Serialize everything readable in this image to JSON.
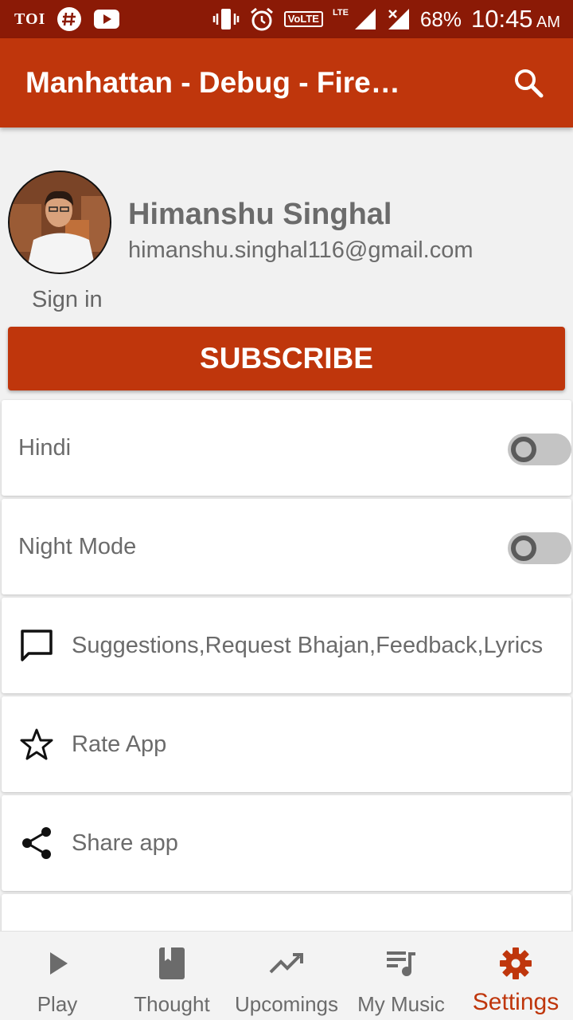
{
  "status_bar": {
    "left_text": "TOI",
    "battery": "68%",
    "time": "10:45",
    "ampm": "AM",
    "volte": "VoLTE",
    "lte": "LTE",
    "icons": [
      "hash-icon",
      "youtube-icon",
      "vibrate-icon",
      "alarm-icon",
      "signal-icon",
      "no-signal-icon"
    ]
  },
  "app_bar": {
    "title": "Manhattan - Debug - Fire…",
    "search_icon": "search-icon"
  },
  "profile": {
    "name": "Himanshu Singhal",
    "email": "himanshu.singhal116@gmail.com",
    "sign_in": "Sign in"
  },
  "subscribe_label": "SUBSCRIBE",
  "settings": [
    {
      "label": "Hindi",
      "type": "toggle",
      "on": false
    },
    {
      "label": "Night Mode",
      "type": "toggle",
      "on": false
    },
    {
      "label": "Suggestions,Request Bhajan,Feedback,Lyrics",
      "type": "link",
      "icon": "comment-icon"
    },
    {
      "label": "Rate App",
      "type": "link",
      "icon": "star-icon"
    },
    {
      "label": "Share app",
      "type": "link",
      "icon": "share-icon"
    }
  ],
  "bottom_nav": {
    "items": [
      {
        "label": "Play",
        "icon": "play-icon",
        "active": false
      },
      {
        "label": "Thought",
        "icon": "book-icon",
        "active": false
      },
      {
        "label": "Upcomings",
        "icon": "trending-icon",
        "active": false
      },
      {
        "label": "My Music",
        "icon": "playlist-icon",
        "active": false
      },
      {
        "label": "Settings",
        "icon": "gear-icon",
        "active": true
      }
    ]
  },
  "colors": {
    "status_bar": "#8b1a06",
    "primary": "#bf360c",
    "text_gray": "#6b6b6b",
    "background": "#f1f1f1"
  }
}
